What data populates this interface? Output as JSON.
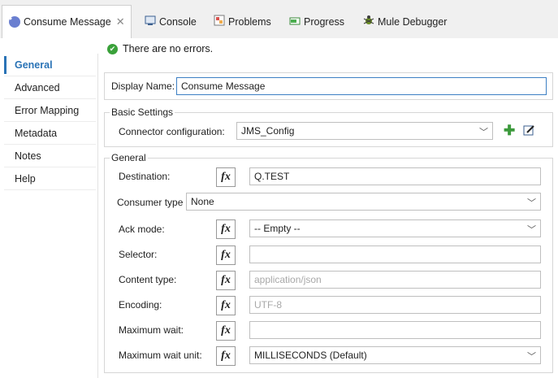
{
  "tabs": [
    {
      "label": "Consume Message",
      "icon": "mule-component-icon",
      "active": true
    },
    {
      "label": "Console",
      "icon": "console-icon"
    },
    {
      "label": "Problems",
      "icon": "problems-icon"
    },
    {
      "label": "Progress",
      "icon": "progress-icon"
    },
    {
      "label": "Mule Debugger",
      "icon": "debugger-icon"
    }
  ],
  "sidebar": {
    "items": [
      {
        "label": "General"
      },
      {
        "label": "Advanced"
      },
      {
        "label": "Error Mapping"
      },
      {
        "label": "Metadata"
      },
      {
        "label": "Notes"
      },
      {
        "label": "Help"
      }
    ]
  },
  "status": {
    "message": "There are no errors."
  },
  "display": {
    "label": "Display Name:",
    "value": "Consume Message"
  },
  "basic": {
    "legend": "Basic Settings",
    "connector_label": "Connector configuration:",
    "connector_value": "JMS_Config"
  },
  "general": {
    "legend": "General",
    "destination_label": "Destination:",
    "destination_value": "Q.TEST",
    "consumer_type_label": "Consumer type",
    "consumer_type_value": "None",
    "ack_mode_label": "Ack mode:",
    "ack_mode_value": "-- Empty --",
    "selector_label": "Selector:",
    "selector_value": "",
    "content_type_label": "Content type:",
    "content_type_placeholder": "application/json",
    "encoding_label": "Encoding:",
    "encoding_placeholder": "UTF-8",
    "max_wait_label": "Maximum wait:",
    "max_wait_value": "",
    "max_wait_unit_label": "Maximum wait unit:",
    "max_wait_unit_value": "MILLISECONDS (Default)",
    "fx_label": "fx"
  },
  "colors": {
    "accent": "#2a73b6",
    "ok": "#3aa13a"
  }
}
